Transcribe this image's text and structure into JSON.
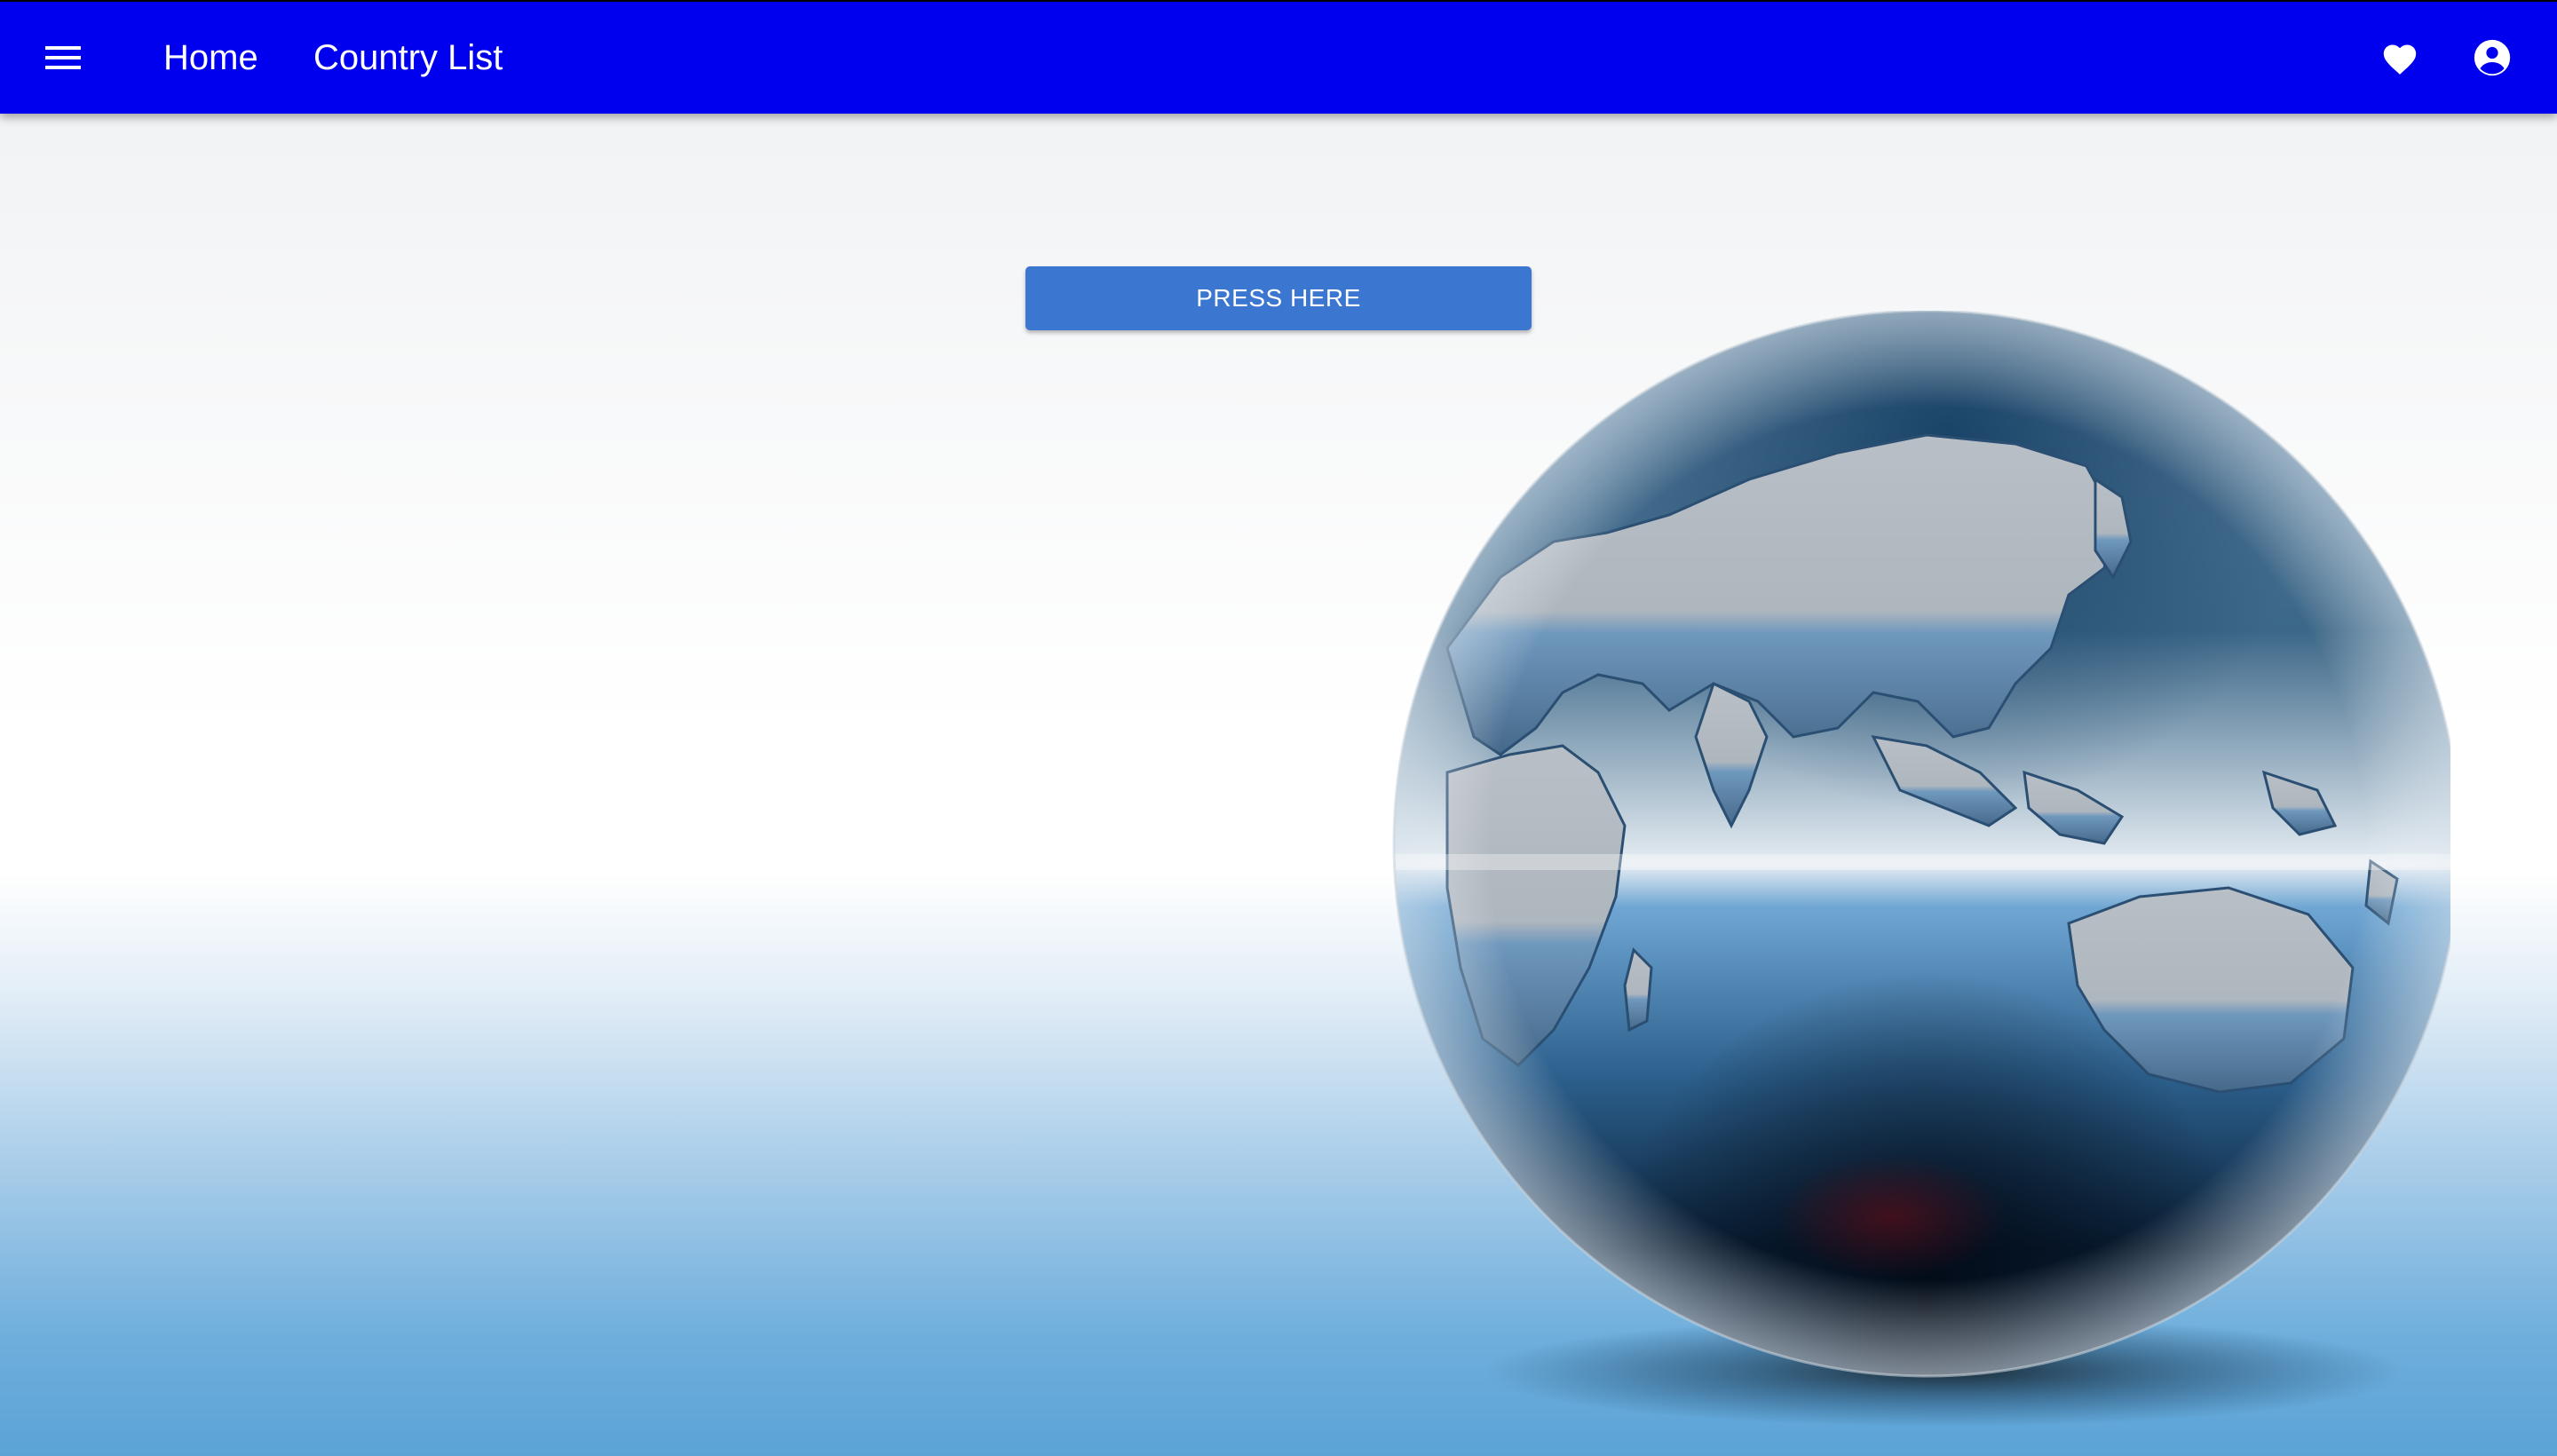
{
  "header": {
    "menu_icon": "menu-icon",
    "nav": [
      {
        "label": "Home"
      },
      {
        "label": "Country List"
      }
    ],
    "favorites_icon": "heart-icon",
    "account_icon": "account-circle-icon",
    "background_color": "#0000ee"
  },
  "main": {
    "button_label": "PRESS HERE",
    "button_color": "#3b76d1",
    "background_image": "globe-image"
  }
}
